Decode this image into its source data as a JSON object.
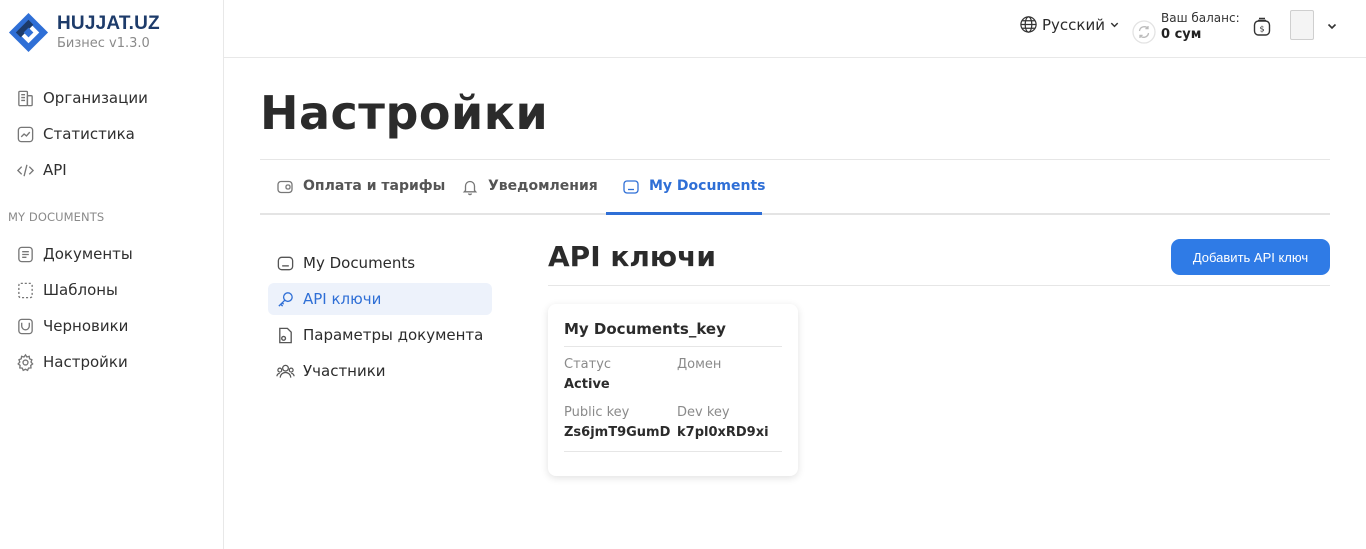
{
  "brand": {
    "name": "HUJJAT.UZ",
    "version": "Бизнес v1.3.0"
  },
  "sidebar": {
    "top_items": [
      {
        "label": "Организации",
        "icon": "building-icon"
      },
      {
        "label": "Статистика",
        "icon": "chart-icon"
      },
      {
        "label": "API",
        "icon": "code-icon"
      }
    ],
    "section_label": "MY DOCUMENTS",
    "section_items": [
      {
        "label": "Документы",
        "icon": "document-icon"
      },
      {
        "label": "Шаблоны",
        "icon": "template-icon"
      },
      {
        "label": "Черновики",
        "icon": "draft-icon"
      },
      {
        "label": "Настройки",
        "icon": "gear-icon"
      }
    ]
  },
  "header": {
    "language": "Русский",
    "balance_label": "Ваш баланс:",
    "balance_value": "0 сум"
  },
  "page": {
    "title": "Настройки"
  },
  "tabs": [
    {
      "label": "Оплата и тарифы",
      "icon": "wallet-icon",
      "active": false
    },
    {
      "label": "Уведомления",
      "icon": "bell-icon",
      "active": false
    },
    {
      "label": "My Documents",
      "icon": "inbox-icon",
      "active": true
    }
  ],
  "submenu": [
    {
      "label": "My Documents",
      "icon": "inbox-icon",
      "active": false
    },
    {
      "label": "API ключи",
      "icon": "key-icon",
      "active": true
    },
    {
      "label": "Параметры документа",
      "icon": "file-settings-icon",
      "active": false
    },
    {
      "label": "Участники",
      "icon": "users-icon",
      "active": false
    }
  ],
  "api_keys": {
    "title": "API ключи",
    "add_button": "Добавить API ключ",
    "card": {
      "name": "My Documents_key",
      "status_label": "Статус",
      "status_value": "Active",
      "domain_label": "Домен",
      "domain_value": "",
      "public_key_label": "Public key",
      "public_key_value": "Zs6jmT9GumD",
      "dev_key_label": "Dev key",
      "dev_key_value": "k7pl0xRD9xi"
    }
  },
  "colors": {
    "accent": "#2f6fd6",
    "button": "#2f7be6",
    "brand": "#1d3b6a"
  }
}
